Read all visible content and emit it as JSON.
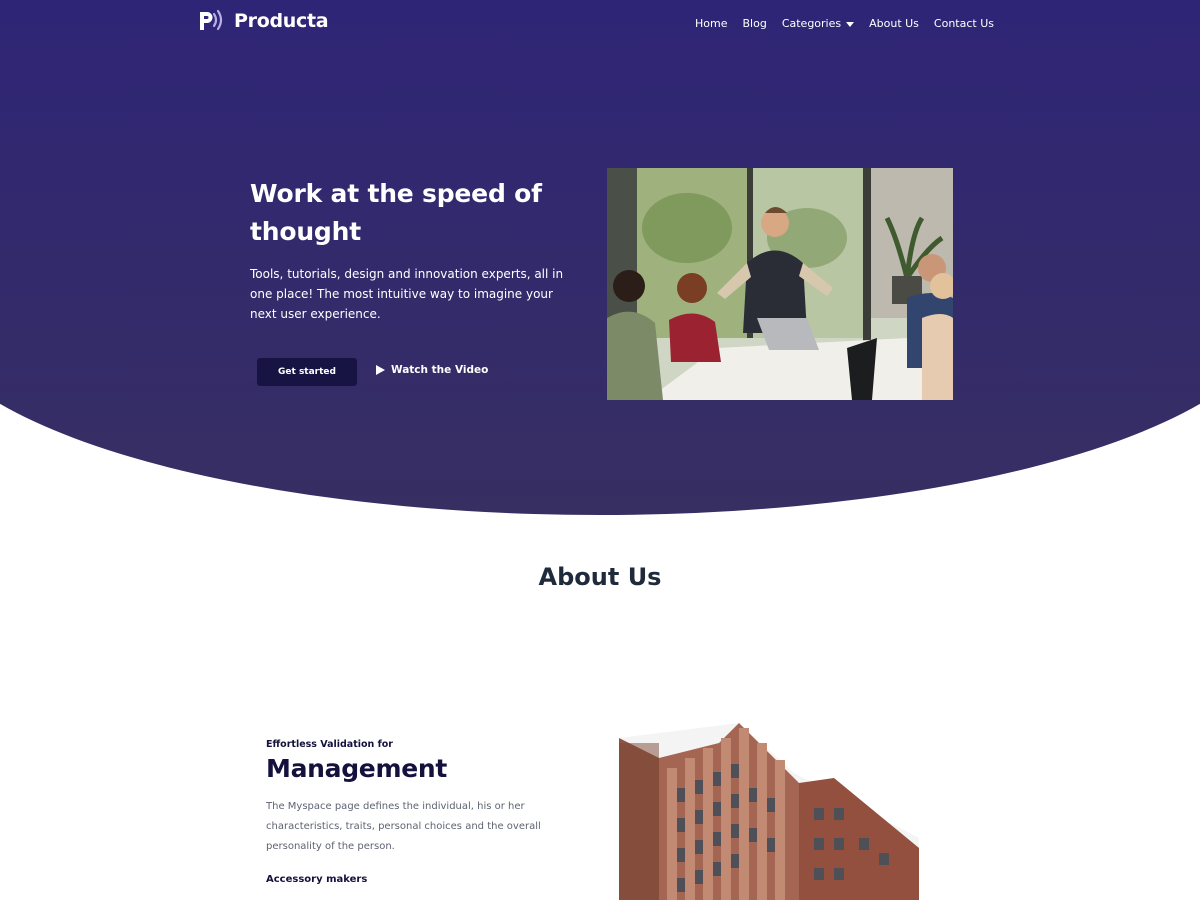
{
  "brand": {
    "name": "Producta"
  },
  "nav": {
    "home": "Home",
    "blog": "Blog",
    "categories": "Categories",
    "about": "About Us",
    "contact": "Contact Us"
  },
  "hero": {
    "title": "Work at the speed of thought",
    "description": "Tools, tutorials, design and innovation experts, all in one place! The most intuitive way to imagine your next user experience.",
    "primary_button": "Get started",
    "video_button": "Watch the Video"
  },
  "about": {
    "title": "About Us",
    "eyebrow": "Effortless Validation for",
    "heading": "Management",
    "description": "The Myspace page defines the individual, his or her characteristics, traits, personal choices and the overall personality of the person.",
    "subheading": "Accessory makers"
  },
  "colors": {
    "hero_top": "#2c1f8a",
    "hero_bottom": "#372f62",
    "button_dark": "#171444",
    "heading_dark": "#14113d"
  }
}
